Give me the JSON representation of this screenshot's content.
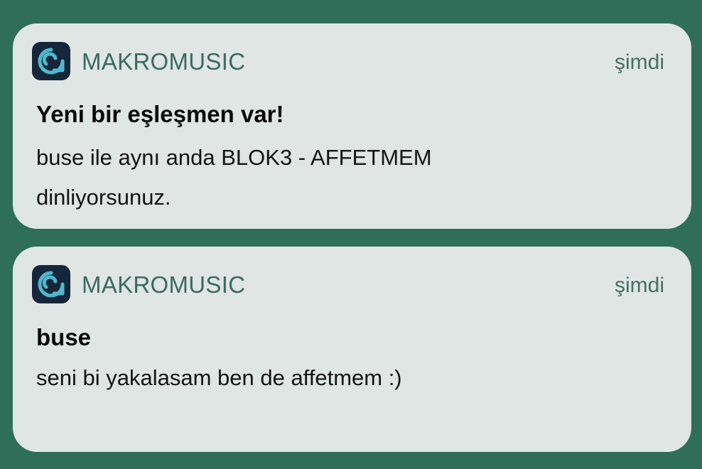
{
  "notifications": [
    {
      "app_icon": "makromusic-app-icon",
      "app_name": "MAKROMUSIC",
      "time": "şimdi",
      "title": "Yeni bir eşleşmen var!",
      "body": "buse ile aynı anda BLOK3 - AFFETMEM dinliyorsunuz."
    },
    {
      "app_icon": "makromusic-app-icon",
      "app_name": "MAKROMUSIC",
      "time": "şimdi",
      "title": "buse",
      "body": "seni bi yakalasam ben de affetmem :)"
    }
  ],
  "colors": {
    "background": "#2f6e58",
    "card": "#dfe6e4",
    "app_icon_bg": "#16263a",
    "app_icon_fg": "#4fb8cc",
    "app_name": "#3d6a60"
  }
}
